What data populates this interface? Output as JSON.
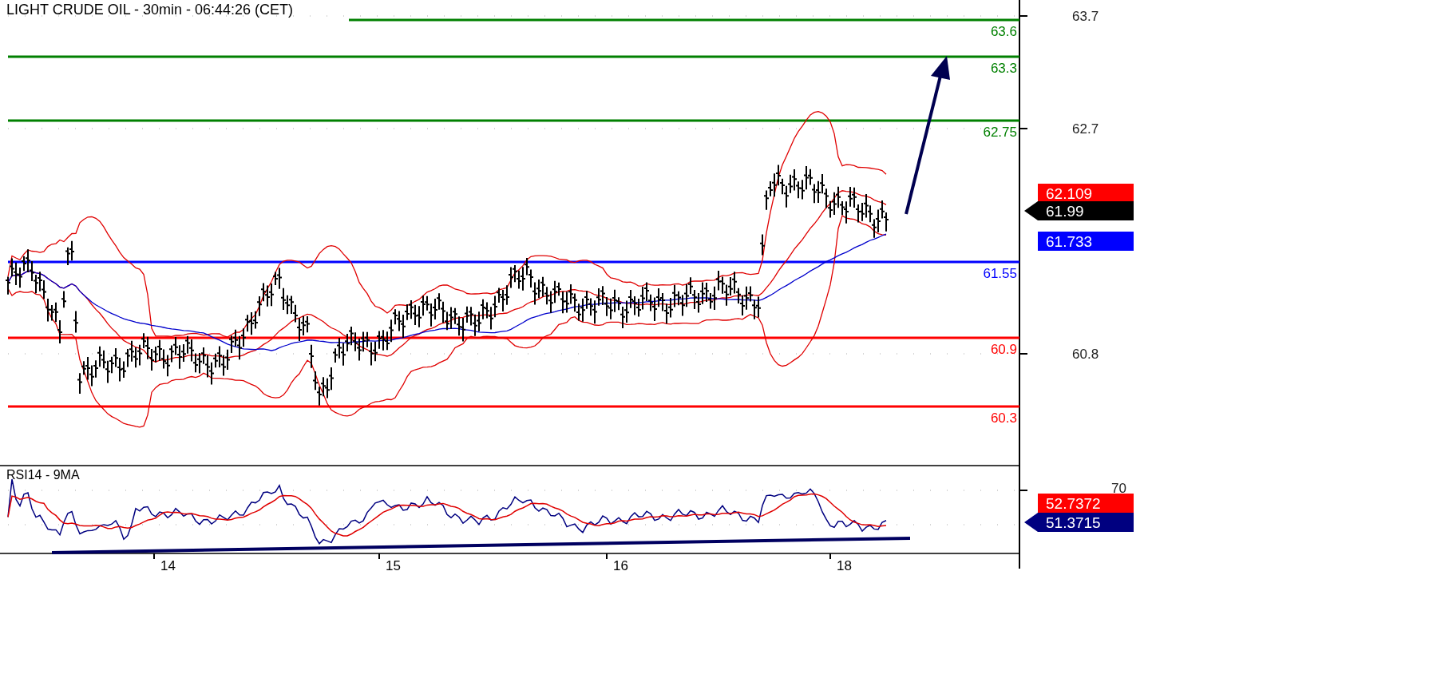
{
  "title": "LIGHT CRUDE OIL - 30min - 06:44:26 (CET)",
  "price_axis": {
    "ticks": [
      "63.7",
      "62.7",
      "60.8"
    ]
  },
  "levels": [
    {
      "label": "63.6",
      "color": "#008000"
    },
    {
      "label": "63.3",
      "color": "#008000"
    },
    {
      "label": "62.75",
      "color": "#008000"
    },
    {
      "label": "61.55",
      "color": "#0000ff"
    },
    {
      "label": "60.9",
      "color": "#ff0000"
    },
    {
      "label": "60.3",
      "color": "#ff0000"
    }
  ],
  "price_tags": [
    {
      "label": "62.109",
      "color": "#ff0000",
      "kind": "plain"
    },
    {
      "label": "61.99",
      "color": "#000000",
      "kind": "pointer"
    },
    {
      "label": "61.733",
      "color": "#0000ff",
      "kind": "plain"
    }
  ],
  "rsi": {
    "title": "RSI14 - 9MA",
    "axis_tick": "70",
    "tags": [
      {
        "label": "52.7372",
        "color": "#ff0000",
        "kind": "plain"
      },
      {
        "label": "51.3715",
        "color": "#000080",
        "kind": "pointer"
      }
    ]
  },
  "x_axis": {
    "labels": [
      "14",
      "15",
      "16",
      "18"
    ]
  }
}
